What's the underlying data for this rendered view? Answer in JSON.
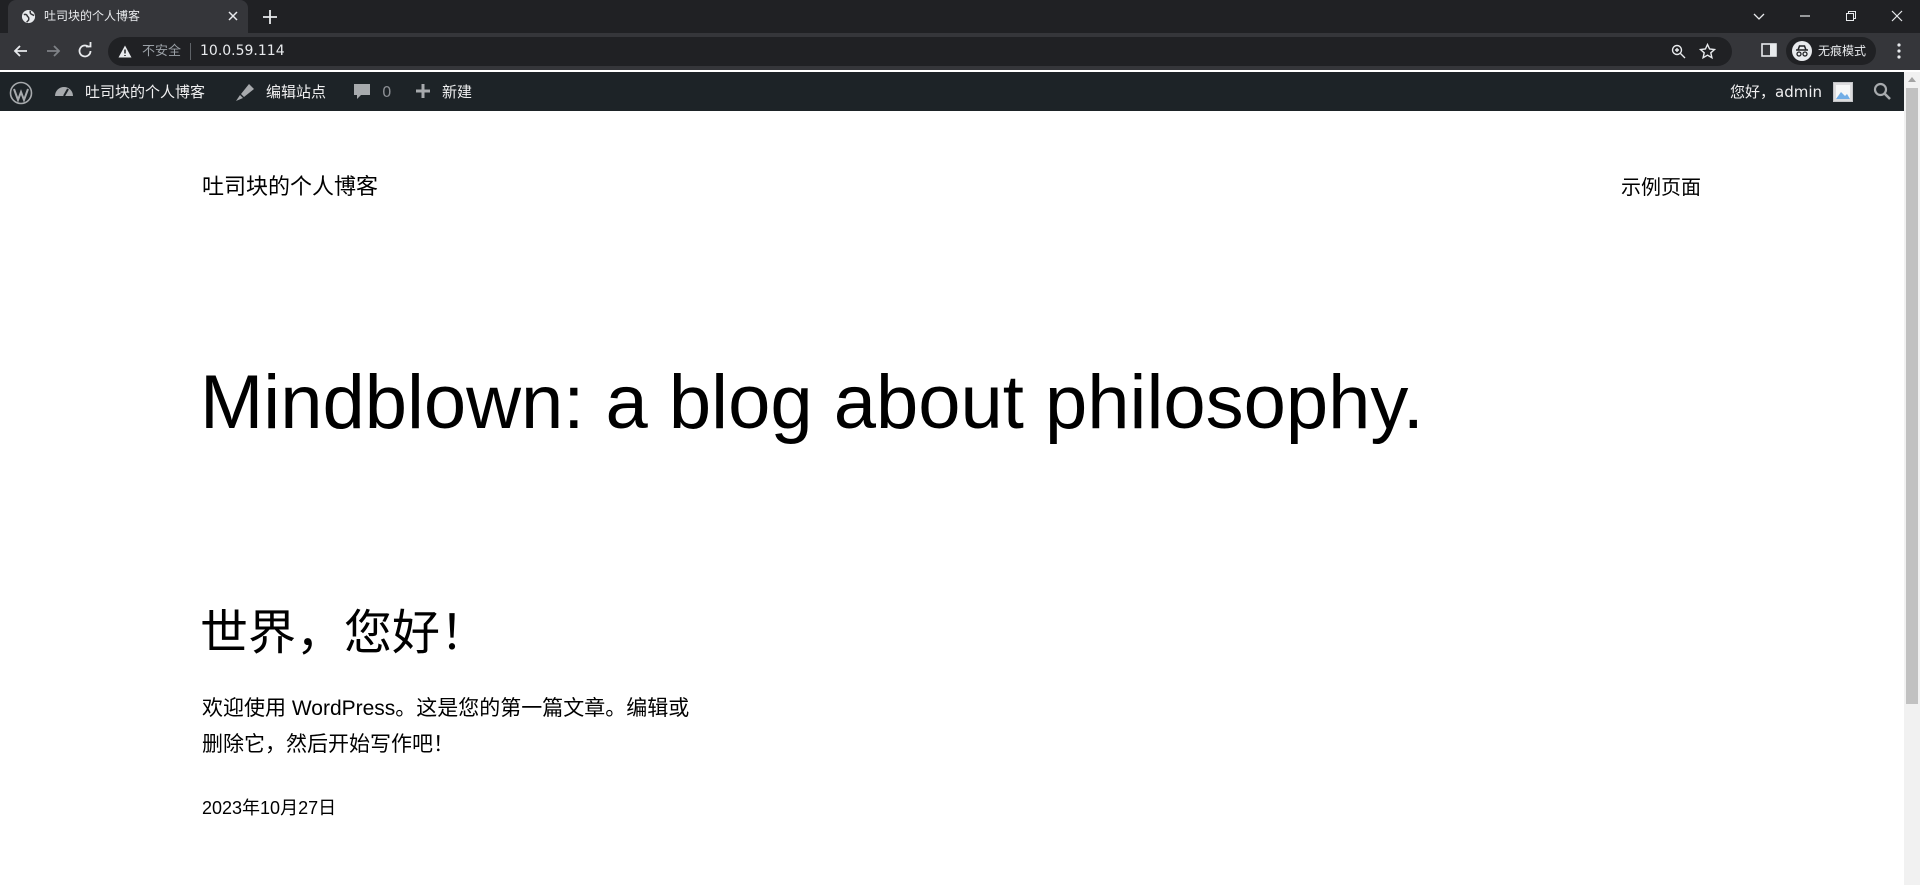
{
  "browser": {
    "tab_title": "吐司块的个人博客",
    "address": {
      "security_label": "不安全",
      "url": "10.0.59.114"
    },
    "incognito_label": "无痕模式"
  },
  "admin_bar": {
    "site_name": "吐司块的个人博客",
    "edit_site": "编辑站点",
    "comments_count": "0",
    "new_label": "新建",
    "greeting": "您好，admin"
  },
  "site": {
    "title": "吐司块的个人博客",
    "nav_item": "示例页面",
    "hero": "Mindblown: a blog about philosophy."
  },
  "post": {
    "title": "世界，您好！",
    "excerpt": "欢迎使用 WordPress。这是您的第一篇文章。编辑或删除它，然后开始写作吧！",
    "date": "2023年10月27日"
  }
}
